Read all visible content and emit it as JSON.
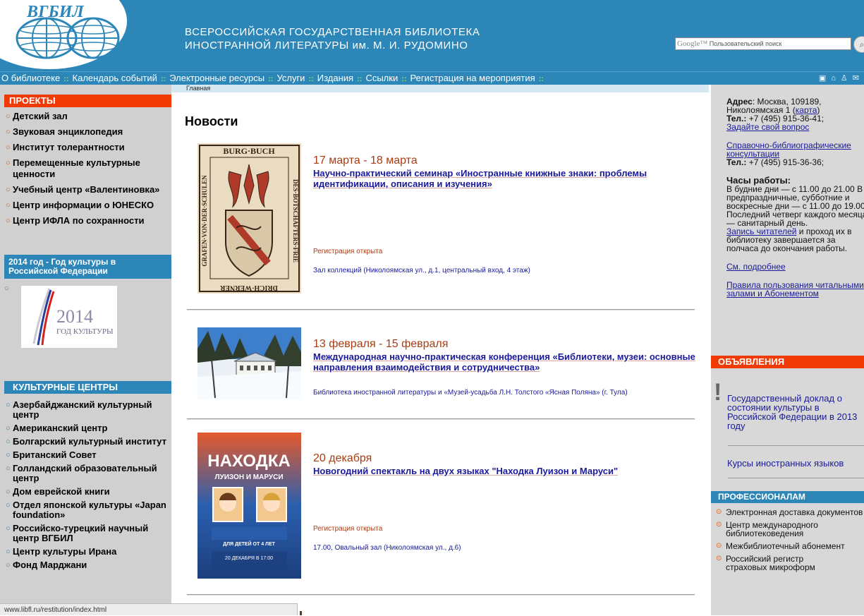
{
  "header": {
    "logo_text": "ВГБИЛ",
    "title_line1": "ВСЕРОССИЙСКАЯ ГОСУДАРСТВЕННАЯ БИБЛИОТЕКА",
    "title_line2": "ИНОСТРАННОЙ ЛИТЕРАТУРЫ им. М. И. РУДОМИНО",
    "search_brand": "Google™",
    "search_placeholder": "Пользовательский поиск"
  },
  "nav": {
    "items": [
      "О библиотеке",
      "Календарь событий",
      "Электронные ресурсы",
      "Услуги",
      "Издания",
      "Ссылки",
      "Регистрация на мероприятия"
    ],
    "separator": "::"
  },
  "breadcrumb": "Главная",
  "left": {
    "projects_title": "ПРОЕКТЫ",
    "projects": [
      "Детский зал",
      "Звуковая энциклопедия",
      "Институт толерантности",
      "Перемещенные культурные ценности",
      "Учебный центр «Валентиновка»",
      "Центр информации о ЮНЕСКО",
      "Центр ИФЛА по сохранности"
    ],
    "year_title": "2014 год - Год культуры в Российской Федерации",
    "year_image_number": "2014",
    "year_image_caption": "ГОД КУЛЬТУРЫ",
    "centers_title": "КУЛЬТУРНЫЕ ЦЕНТРЫ",
    "centers": [
      "Азербайджанский культурный центр",
      "Американский центр",
      "Болгарский культурный институт",
      "Британский Совет",
      "Голландский образовательный центр",
      "Дом еврейской книги",
      "Отдел японской культуры «Japan foundation»",
      "Российско-турецкий научный центр ВГБИЛ",
      "Центр культуры Ирана",
      "Фонд Марджани"
    ]
  },
  "main": {
    "title": "Новости",
    "news": [
      {
        "date": "17 марта - 18 марта",
        "title": "Научно-практический семинар «Иностранные книжные знаки: проблемы идентификации, описания и изучения»",
        "status": "Регистрация открыта",
        "venue": "Зал коллекций (Николоямская ул., д.1, центральный вход, 4 этаж)",
        "image_top_text": "BURG·BUCH",
        "image_left_text": "GRAFEN·VON·DER·SCHULEN",
        "image_right_text": "DES·BOTSCHAFTERS·FRIE",
        "image_bottom_text": "DRICH·WERNER"
      },
      {
        "date": "13 февраля - 15 февраля",
        "title": "Международная научно-практическая конференция «Библиотеки, музеи: основные направления взаимодействия и сотрудничества»",
        "venue": "Библиотека иностранной литературы и «Музей-усадьба Л.Н. Толстого «Ясная Поляна» (г. Тула)"
      },
      {
        "date": "20 декабря",
        "title": "Новогодний спектакль на двух языках \"Находка Луизон и Маруси\"",
        "status": "Регистрация открыта",
        "venue": "17.00, Овальный зал (Николоямская ул., д.6)",
        "poster_title": "НАХОДКА",
        "poster_subtitle": "ЛУИЗОН И МАРУСИ",
        "poster_age": "ДЛЯ ДЕТЕЙ ОТ 4 ЛЕТ",
        "poster_date": "20 ДЕКАБРЯ В 17:00"
      }
    ]
  },
  "right": {
    "address_label": "Адрес",
    "address_text": ": Москва, 109189, Николоямская 1",
    "map_link": "карта",
    "tel_label": "Тел.:",
    "tel1": " +7 (495) 915-36-41;",
    "ask_link": "Задайте свой вопрос",
    "ref_link": "Справочно-библиографические консультации",
    "tel2": " +7 (495) 915-36-36;",
    "hours_title": "Часы работы:",
    "hours_text": "В будние дни — с 11.00 до 21.00 В предпраздничные, субботние и воскресные дни — с 11.00 до 19.00. Последний четверг каждого месяца — санитарный день.",
    "readers_link": "Запись читателей",
    "readers_text": " и проход их в библиотеку завершается за полчаса до окончания работы.",
    "more_link": "См. подробнее",
    "rules_link": "Правила пользования читальными залами и Абонементом",
    "announcements_title": "ОБЪЯВЛЕНИЯ",
    "announcement1": "Государственный доклад о состоянии культуры в Российской Федерации в 2013 году",
    "announcement2": "Курсы иностранных языков",
    "prof_title": "ПРОФЕССИОНАЛАМ",
    "prof_items": [
      "Электронная доставка документов",
      "Центр международного библиотековедения",
      "Межбиблиотечный абонемент",
      "Российский регистр страховых микроформ"
    ]
  },
  "status_bar": "www.libfl.ru/restitution/index.html",
  "colors": {
    "header_blue": "#2c86b8",
    "orange_head": "#f13b06",
    "sidebar_gray": "#d0d0d0",
    "date_red": "#a83c12",
    "link_blue": "#1a1a9a"
  }
}
